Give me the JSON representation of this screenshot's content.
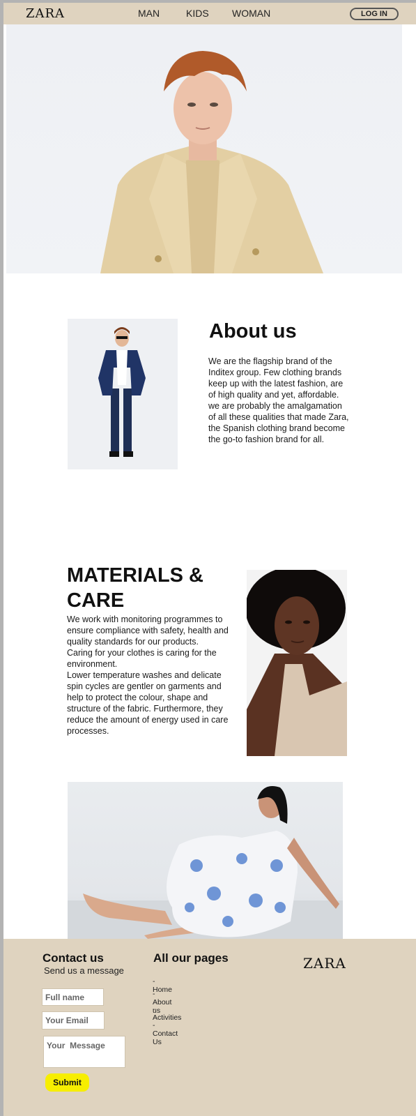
{
  "header": {
    "logo": "ZARA",
    "nav": [
      "MAN",
      "KIDS",
      "WOMAN"
    ],
    "login_label": "LOG IN"
  },
  "hero": {
    "image": "man-in-beige-suit-portrait"
  },
  "about": {
    "image": "man-in-navy-suit",
    "title": "About us",
    "text": "We are the flagship brand of the Inditex group. Few clothing brands keep up with the latest fashion, are of high quality and yet, affordable. we are probably the amalgamation of all these qualities that made Zara, the Spanish clothing brand become the go-to fashion brand for all."
  },
  "materials": {
    "title": "MATERIALS & CARE",
    "paragraphs": [
      "We work with monitoring programmes to ensure compliance with safety, health and quality standards for our products.",
      "Caring for your clothes is caring for the environment.",
      "Lower temperature washes and delicate spin cycles are gentler on garments and help to protect the colour, shape and structure of the fabric. Furthermore, they reduce the amount of energy used in care processes."
    ],
    "image": "woman-in-beige-tank-top"
  },
  "feature": {
    "image": "woman-in-blue-floral-dress-seated"
  },
  "footer": {
    "contact_title": "Contact us",
    "contact_subtitle": "Send us a message",
    "full_name_placeholder": "Full name",
    "email_placeholder": "Your Email",
    "message_placeholder": "Your  Message",
    "submit_label": "Submit",
    "pages_title": "All our pages",
    "links": [
      "-Home",
      "-About us",
      "-Activities",
      "-Contact Us"
    ],
    "logo": "ZARA"
  },
  "colors": {
    "header_bg": "#dfd3bf",
    "footer_bg": "#dfd3bf",
    "submit_bg": "#f7ee00",
    "page_bg": "#ffffff"
  }
}
